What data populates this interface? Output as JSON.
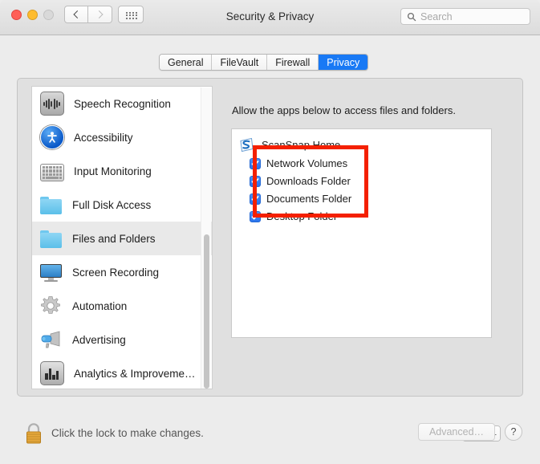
{
  "window": {
    "title": "Security & Privacy",
    "traffic_lights": {
      "close": "close-button",
      "minimize": "minimize-button",
      "zoom": "zoom-button-disabled"
    },
    "nav": {
      "back": "back-icon",
      "forward": "forward-icon",
      "grid": "show-all-icon"
    },
    "search": {
      "placeholder": "Search",
      "value": "",
      "icon": "search-icon"
    }
  },
  "tabs": [
    {
      "label": "General",
      "active": false
    },
    {
      "label": "FileVault",
      "active": false
    },
    {
      "label": "Firewall",
      "active": false
    },
    {
      "label": "Privacy",
      "active": true
    }
  ],
  "sidebar": {
    "items": [
      {
        "label": "Speech Recognition",
        "icon": "waveform-icon",
        "selected": false
      },
      {
        "label": "Accessibility",
        "icon": "accessibility-icon",
        "selected": false
      },
      {
        "label": "Input Monitoring",
        "icon": "keyboard-icon",
        "selected": false
      },
      {
        "label": "Full Disk Access",
        "icon": "folder-icon",
        "selected": false
      },
      {
        "label": "Files and Folders",
        "icon": "folder-icon",
        "selected": true
      },
      {
        "label": "Screen Recording",
        "icon": "display-icon",
        "selected": false
      },
      {
        "label": "Automation",
        "icon": "gear-icon",
        "selected": false
      },
      {
        "label": "Advertising",
        "icon": "megaphone-icon",
        "selected": false
      },
      {
        "label": "Analytics & Improveme…",
        "icon": "bar-chart-icon",
        "selected": false
      }
    ]
  },
  "main": {
    "instruction": "Allow the apps below to access files and folders.",
    "app": {
      "name": "ScanSnap Home",
      "icon": "scansnap-icon",
      "permissions": [
        {
          "label": "Network Volumes",
          "checked": true
        },
        {
          "label": "Downloads Folder",
          "checked": true
        },
        {
          "label": "Documents Folder",
          "checked": true
        },
        {
          "label": "Desktop Folder",
          "checked": true
        }
      ]
    },
    "list_buttons": {
      "add": "+",
      "remove": "—"
    },
    "annotation": {
      "color": "#f42000",
      "shape": "rectangle"
    }
  },
  "bottom": {
    "lock_icon": "lock-closed-icon",
    "lock_text": "Click the lock to make changes.",
    "advanced_label": "Advanced…",
    "help_label": "?"
  },
  "colors": {
    "accent": "#1879f5",
    "checkbox": "#2a74ed",
    "annotation": "#f42000",
    "window_bg": "#ececec",
    "panel_bg": "#e0e0e0"
  }
}
